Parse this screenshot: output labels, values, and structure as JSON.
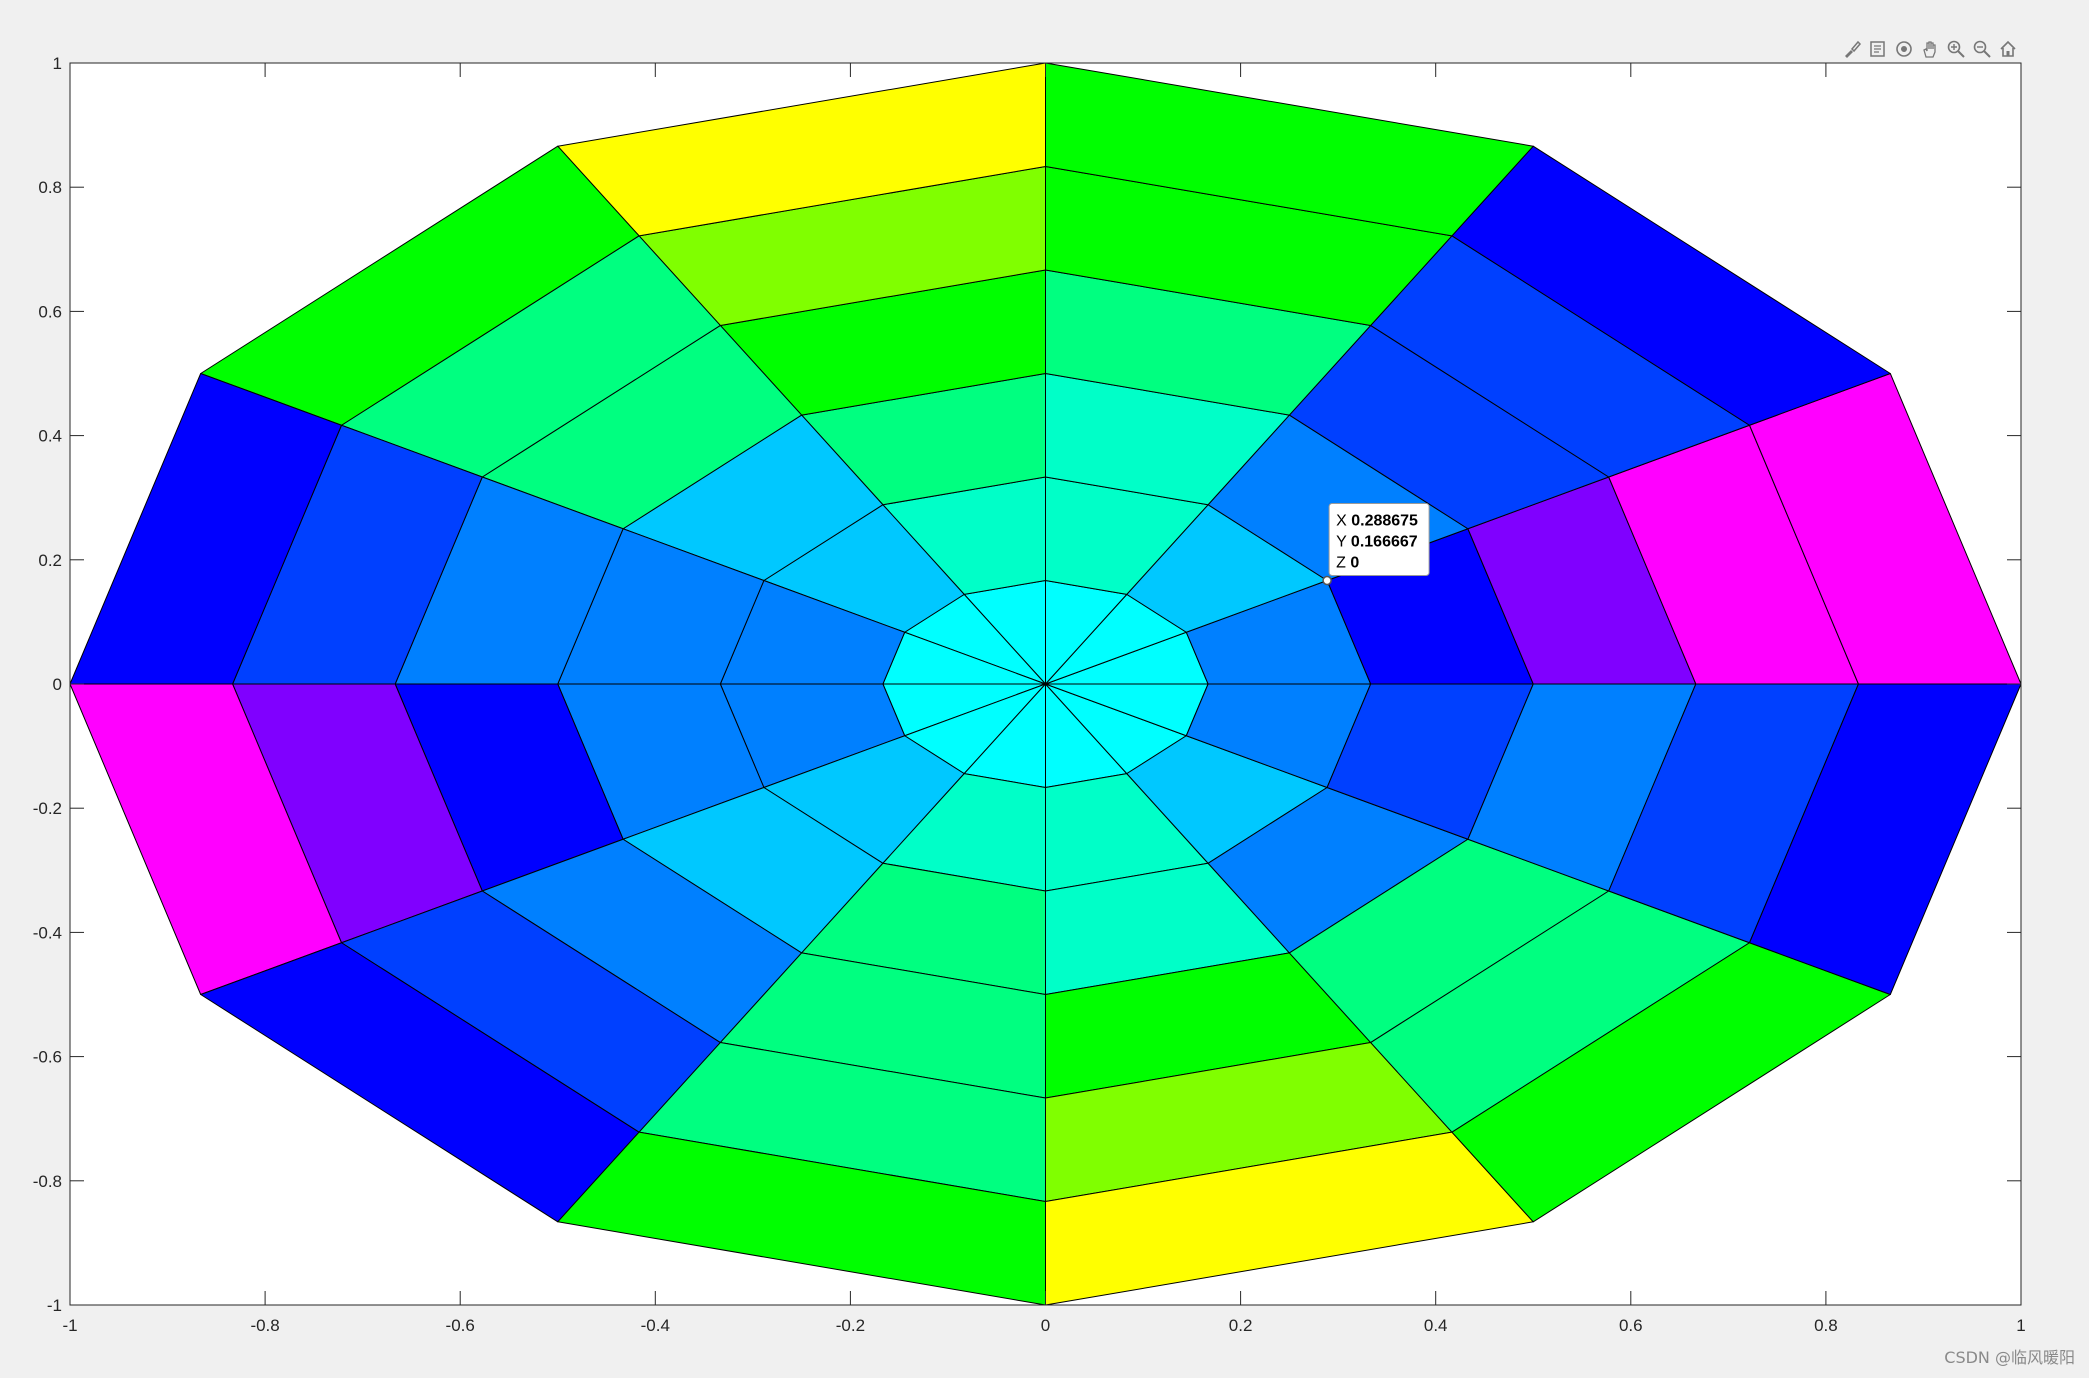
{
  "chart_data": {
    "type": "surface",
    "view": "2D top view (pseudocolor polar mesh)",
    "colormap": "hsv",
    "x_range": [
      -1,
      1
    ],
    "y_range": [
      -1,
      1
    ],
    "x_ticks": [
      -1,
      -0.8,
      -0.6,
      -0.4,
      -0.2,
      0,
      0.2,
      0.4,
      0.6,
      0.8,
      1
    ],
    "x_tick_labels": [
      "-1",
      "-0.8",
      "-0.6",
      "-0.4",
      "-0.2",
      "0",
      "0.2",
      "0.4",
      "0.6",
      "0.8",
      "1"
    ],
    "y_ticks": [
      -1,
      -0.8,
      -0.6,
      -0.4,
      -0.2,
      0,
      0.2,
      0.4,
      0.6,
      0.8,
      1
    ],
    "y_tick_labels": [
      "-1",
      "-0.8",
      "-0.6",
      "-0.4",
      "-0.2",
      "0",
      "0.2",
      "0.4",
      "0.6",
      "0.8",
      "1"
    ],
    "mesh": {
      "radii": [
        0,
        0.166667,
        0.333333,
        0.5,
        0.666667,
        0.833333,
        1
      ],
      "angles_deg": [
        0,
        30,
        60,
        90,
        120,
        150,
        180,
        210,
        240,
        270,
        300,
        330,
        360
      ]
    },
    "cell_colors": [
      [
        "#00ffff",
        "#00ffff",
        "#00ffff",
        "#00ffff",
        "#00ffff",
        "#00ffff",
        "#00ffff",
        "#00ffff",
        "#00ffff",
        "#00ffff",
        "#00ffff",
        "#00ffff"
      ],
      [
        "#0080ff",
        "#00c8ff",
        "#00ffc8",
        "#00ffc8",
        "#00c8ff",
        "#0080ff",
        "#0080ff",
        "#00c8ff",
        "#00ffc8",
        "#00ffc8",
        "#00c8ff",
        "#0080ff"
      ],
      [
        "#0000ff",
        "#0080ff",
        "#00ffc8",
        "#00ff80",
        "#00c8ff",
        "#0080ff",
        "#0080ff",
        "#00c8ff",
        "#00ff80",
        "#00ffc8",
        "#0080ff",
        "#0040ff"
      ],
      [
        "#8000ff",
        "#0040ff",
        "#00ff80",
        "#00ff00",
        "#00ff80",
        "#0080ff",
        "#0000ff",
        "#0080ff",
        "#00ff80",
        "#00ff00",
        "#00ff80",
        "#0080ff"
      ],
      [
        "#ff00ff",
        "#0040ff",
        "#00ff00",
        "#80ff00",
        "#00ff80",
        "#0040ff",
        "#8000ff",
        "#0040ff",
        "#00ff80",
        "#80ff00",
        "#00ff80",
        "#0040ff"
      ],
      [
        "#ff00ff",
        "#0000ff",
        "#00ff00",
        "#ffff00",
        "#00ff00",
        "#0000ff",
        "#ff00ff",
        "#0000ff",
        "#00ff00",
        "#ffff00",
        "#00ff00",
        "#0000ff"
      ],
      [
        "#ff0080",
        "#4000ff",
        "#40ff00",
        "#ff8000",
        "#40ff00",
        "#4000ff",
        "#ff0080",
        "#4000ff",
        "#40ff00",
        "#ff8000",
        "#40ff00",
        "#4000ff"
      ]
    ],
    "datatip": {
      "x": 0.288675,
      "y": 0.166667,
      "lines": [
        {
          "name": "X",
          "value": "0.288675"
        },
        {
          "name": "Y",
          "value": "0.166667"
        },
        {
          "name": "Z",
          "value": "0"
        }
      ]
    },
    "grid": false,
    "legend": "none"
  },
  "toolbar": {
    "buttons": [
      {
        "name": "brush-icon"
      },
      {
        "name": "datatip-icon"
      },
      {
        "name": "rotate-3d-icon"
      },
      {
        "name": "pan-hand-icon"
      },
      {
        "name": "zoom-in-icon"
      },
      {
        "name": "zoom-out-icon"
      },
      {
        "name": "home-icon"
      }
    ]
  },
  "watermark": "CSDN @临风暖阳"
}
